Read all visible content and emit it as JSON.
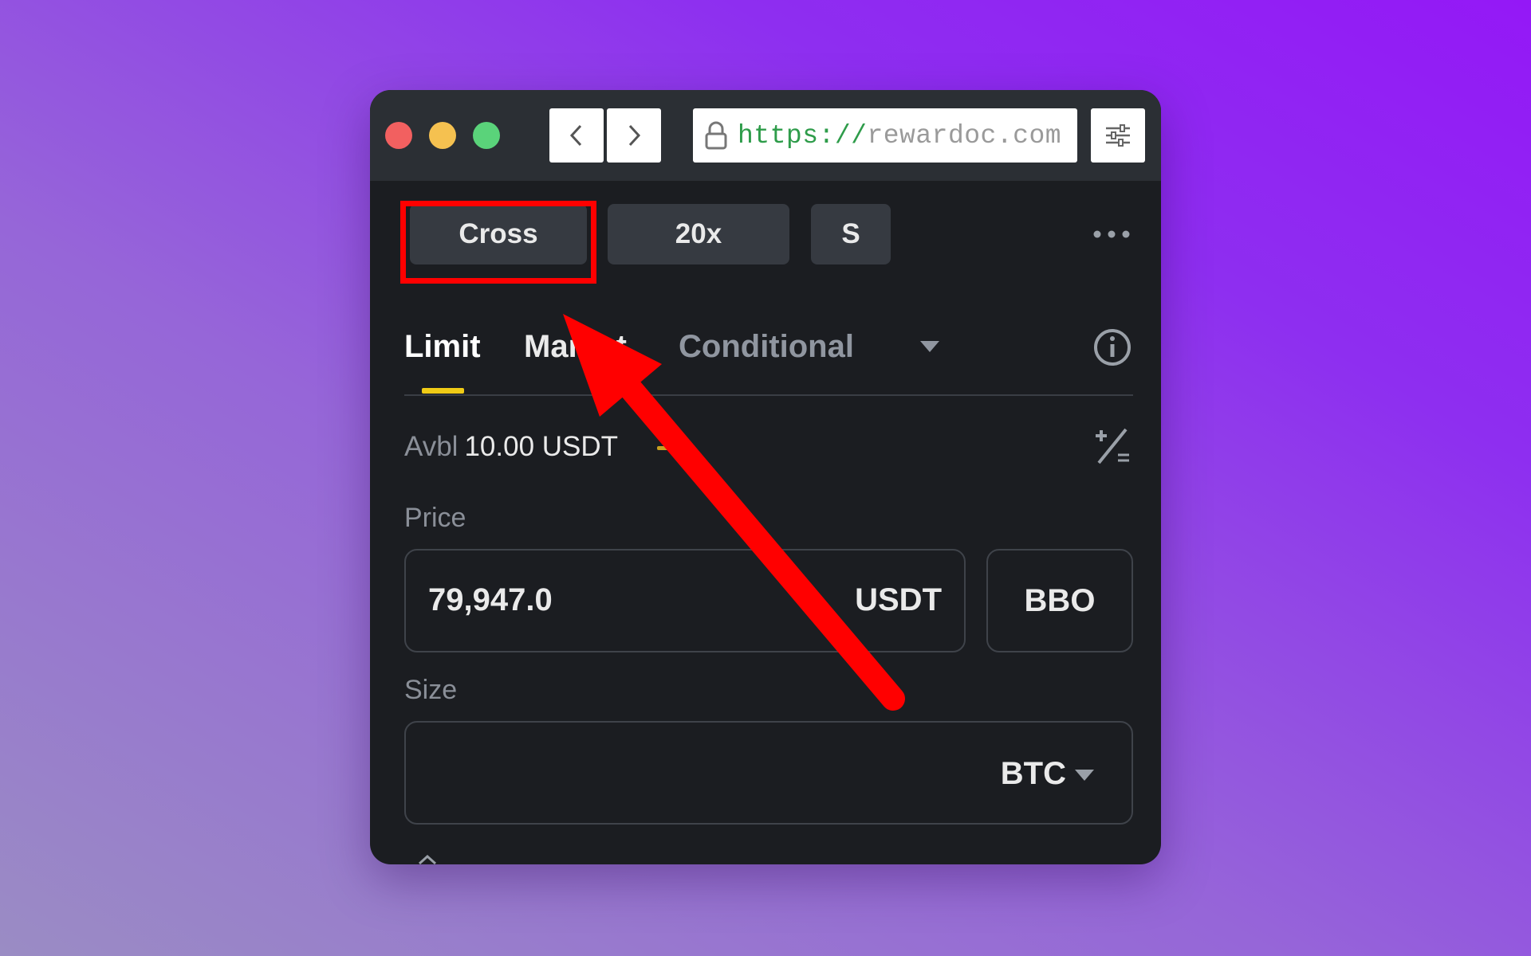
{
  "browser": {
    "url_protocol": "https://",
    "url_host": "rewardoc.com",
    "buttons": {
      "back_icon": "chevron-left-icon",
      "forward_icon": "chevron-right-icon",
      "menu_icon": "sliders-icon"
    },
    "traffic_lights": [
      "#f26060",
      "#f5c150",
      "#5ad37a"
    ]
  },
  "toolbar": {
    "margin_mode": "Cross",
    "leverage": "20x",
    "position_mode": "S",
    "more_icon": "ellipsis-icon"
  },
  "order_tabs": {
    "limit": "Limit",
    "market": "Market",
    "conditional": "Conditional",
    "active": "Limit"
  },
  "available": {
    "label": "Avbl",
    "value": "10.00 USDT"
  },
  "price": {
    "label": "Price",
    "value": "79,947.0",
    "unit": "USDT",
    "bbo_label": "BBO"
  },
  "size": {
    "label": "Size",
    "unit": "BTC"
  },
  "colors": {
    "accent": "#f0cb16",
    "highlight": "#ff0000",
    "panel_bg": "#1b1d21"
  }
}
